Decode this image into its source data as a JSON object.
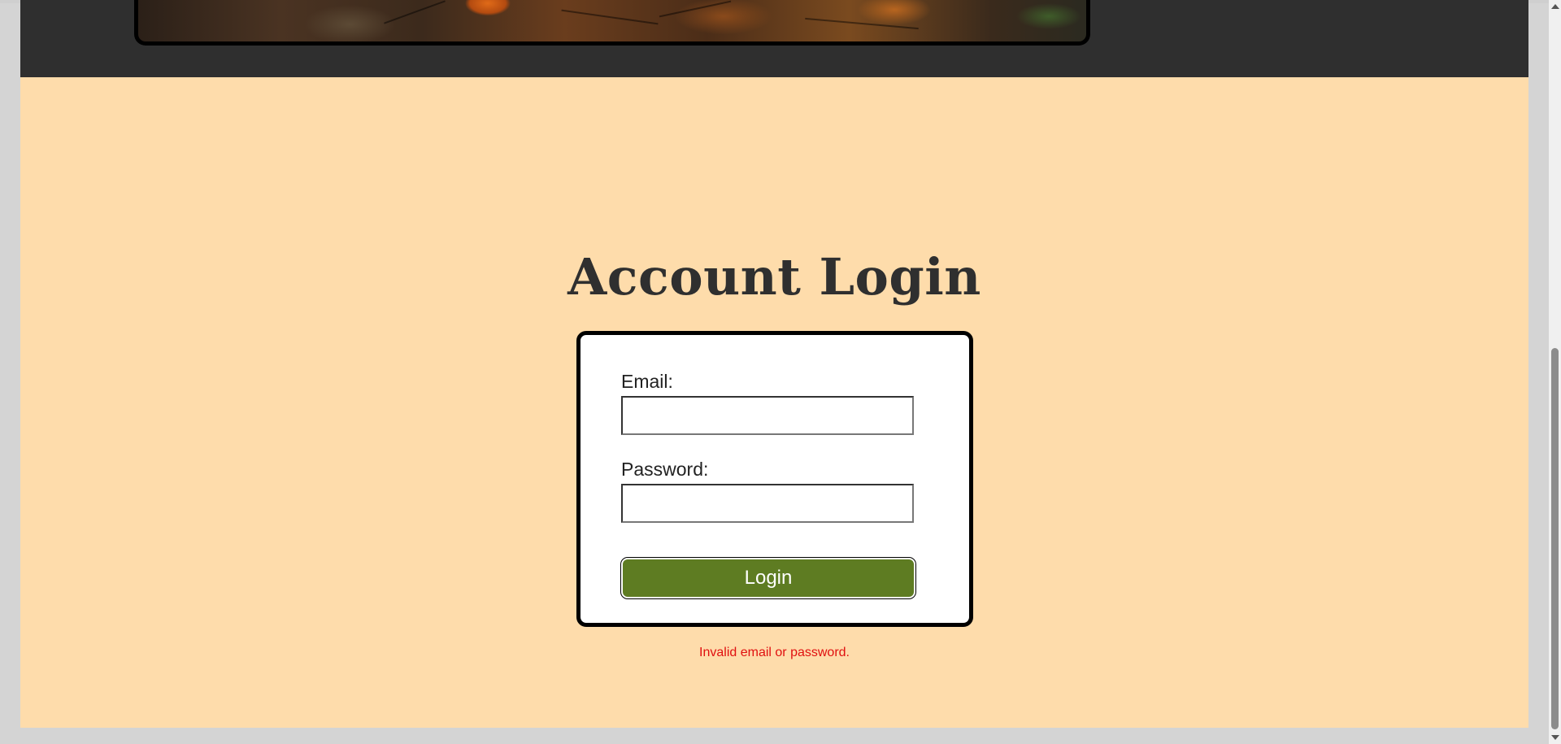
{
  "header": {
    "banner_description_icon": "forest-floor-banner"
  },
  "main": {
    "title": "Account Login"
  },
  "login_form": {
    "email_label": "Email:",
    "email_value": "",
    "password_label": "Password:",
    "password_value": "",
    "login_button_label": "Login"
  },
  "error": {
    "message": "Invalid email or password."
  },
  "colors": {
    "page_background": "#fedcab",
    "header_background": "#2f2f2f",
    "button_green": "#5e7c22",
    "error_red": "#e01010"
  }
}
